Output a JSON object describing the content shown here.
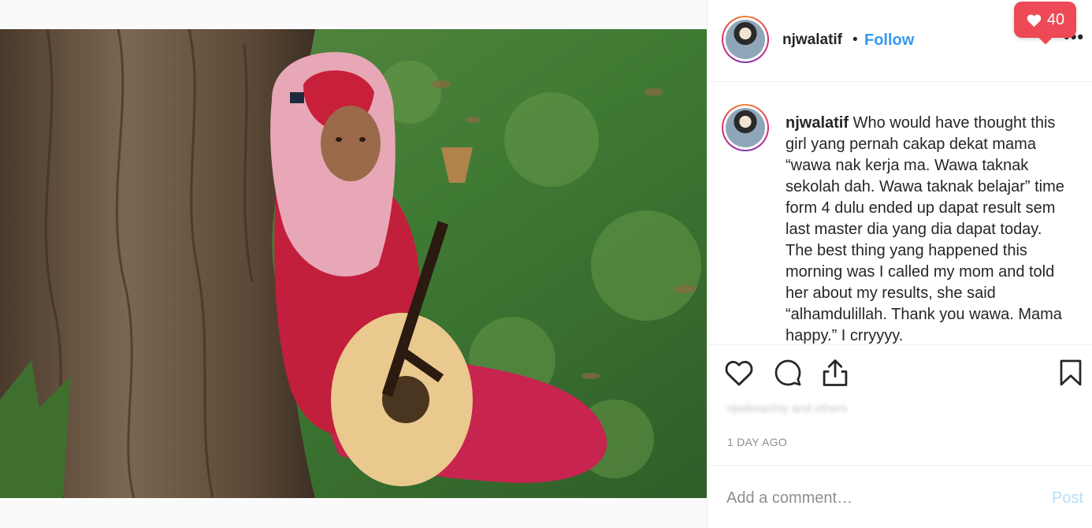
{
  "post": {
    "image_alt": "",
    "username": "njwalatif",
    "separator": "•",
    "follow_label": "Follow",
    "more_icon": "•••"
  },
  "notification": {
    "likes_count": "40",
    "icon": "heart-icon",
    "color": "#ed4956"
  },
  "caption": {
    "username": "njwalatif",
    "text": "Who would have thought this girl yang pernah cakap dekat mama “wawa nak kerja ma. Wawa taknak sekolah dah. Wawa taknak belajar” time form 4 dulu ended up dapat result sem last master dia yang dia dapat today. The best thing yang happened this morning was I called my mom and told her about my results, she said “alhamdulillah. Thank you wawa. Mama happy.” I crryyyy."
  },
  "actions": {
    "like_icon": "heart-outline-icon",
    "comment_icon": "comment-icon",
    "share_icon": "share-icon",
    "save_icon": "bookmark-icon"
  },
  "liked_by_blurred": "njwikeachty and others",
  "timestamp": "1 DAY AGO",
  "comment": {
    "placeholder": "Add a comment…",
    "post_label": "Post"
  },
  "colors": {
    "accent": "#3897f0",
    "post_disabled": "#b2dffc",
    "like": "#ed4956"
  }
}
